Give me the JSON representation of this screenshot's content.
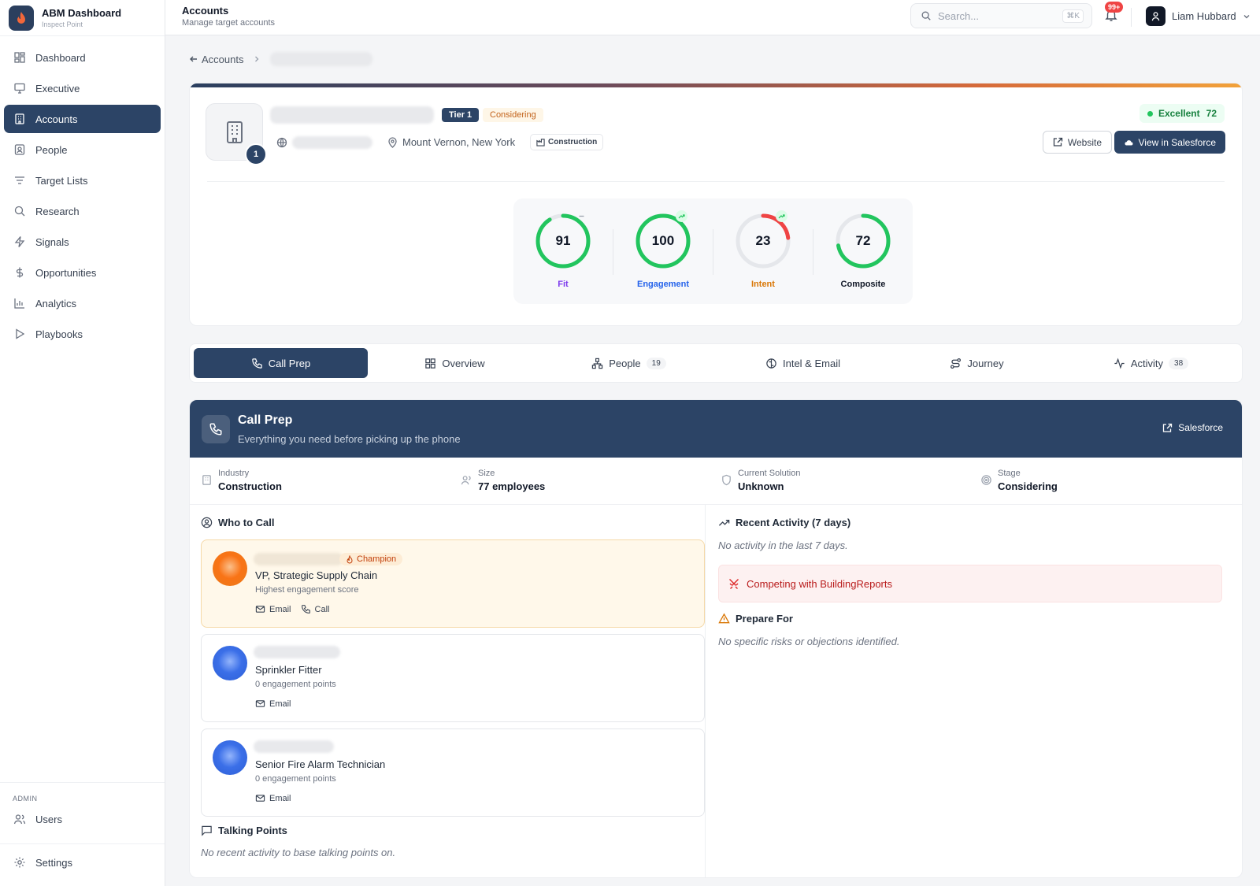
{
  "brand": {
    "title": "ABM Dashboard",
    "subtitle": "Inspect Point"
  },
  "nav": [
    {
      "label": "Dashboard",
      "icon": "grid-icon"
    },
    {
      "label": "Executive",
      "icon": "monitor-icon"
    },
    {
      "label": "Accounts",
      "icon": "building-icon",
      "active": true
    },
    {
      "label": "People",
      "icon": "id-card-icon"
    },
    {
      "label": "Target Lists",
      "icon": "filter-icon"
    },
    {
      "label": "Research",
      "icon": "search-icon"
    },
    {
      "label": "Signals",
      "icon": "zap-icon"
    },
    {
      "label": "Opportunities",
      "icon": "dollar-icon"
    },
    {
      "label": "Analytics",
      "icon": "bar-chart-icon"
    },
    {
      "label": "Playbooks",
      "icon": "play-icon"
    }
  ],
  "admin": {
    "label": "ADMIN",
    "users": "Users",
    "settings": "Settings"
  },
  "header": {
    "title": "Accounts",
    "subtitle": "Manage target accounts",
    "search_placeholder": "Search...",
    "shortcut": "⌘K",
    "notif_count": "99+",
    "user_name": "Liam Hubbard"
  },
  "breadcrumb": {
    "back": "Accounts"
  },
  "account": {
    "tier": "Tier 1",
    "stage": "Considering",
    "location": "Mount Vernon, New York",
    "industry": "Construction",
    "health_label": "Excellent",
    "health_score": "72",
    "website_label": "Website",
    "salesforce_label": "View in Salesforce",
    "rank": "1"
  },
  "scores": [
    {
      "label": "Fit",
      "value": 91,
      "color": "#22c55e",
      "label_color": "#7c3aed",
      "trend": "flat"
    },
    {
      "label": "Engagement",
      "value": 100,
      "color": "#22c55e",
      "label_color": "#2563eb",
      "trend": "up"
    },
    {
      "label": "Intent",
      "value": 23,
      "color": "#ef4444",
      "label_color": "#d97706",
      "trend": "up"
    },
    {
      "label": "Composite",
      "value": 72,
      "color": "#22c55e",
      "label_color": "#111827",
      "trend": "none"
    }
  ],
  "tabs": [
    {
      "label": "Call Prep",
      "count": "",
      "active": true
    },
    {
      "label": "Overview",
      "count": ""
    },
    {
      "label": "People",
      "count": "19"
    },
    {
      "label": "Intel & Email",
      "count": ""
    },
    {
      "label": "Journey",
      "count": ""
    },
    {
      "label": "Activity",
      "count": "38"
    }
  ],
  "callprep": {
    "title": "Call Prep",
    "subtitle": "Everything you need before picking up the phone",
    "salesforce": "Salesforce",
    "facts": [
      {
        "label": "Industry",
        "value": "Construction"
      },
      {
        "label": "Size",
        "value": "77 employees"
      },
      {
        "label": "Current Solution",
        "value": "Unknown"
      },
      {
        "label": "Stage",
        "value": "Considering"
      }
    ],
    "who_to_call": "Who to Call",
    "contacts": [
      {
        "title": "VP, Strategic Supply Chain",
        "note": "Highest engagement score",
        "badge": "Champion",
        "email": "Email",
        "call": "Call"
      },
      {
        "title": "Sprinkler Fitter",
        "note": "0 engagement points",
        "email": "Email"
      },
      {
        "title": "Senior Fire Alarm Technician",
        "note": "0 engagement points",
        "email": "Email"
      }
    ],
    "talking_points": {
      "title": "Talking Points",
      "empty": "No recent activity to base talking points on."
    },
    "recent_activity": {
      "title": "Recent Activity (7 days)",
      "empty": "No activity in the last 7 days."
    },
    "competitor": "Competing with BuildingReports",
    "prepare": {
      "title": "Prepare For",
      "empty": "No specific risks or objections identified."
    }
  }
}
